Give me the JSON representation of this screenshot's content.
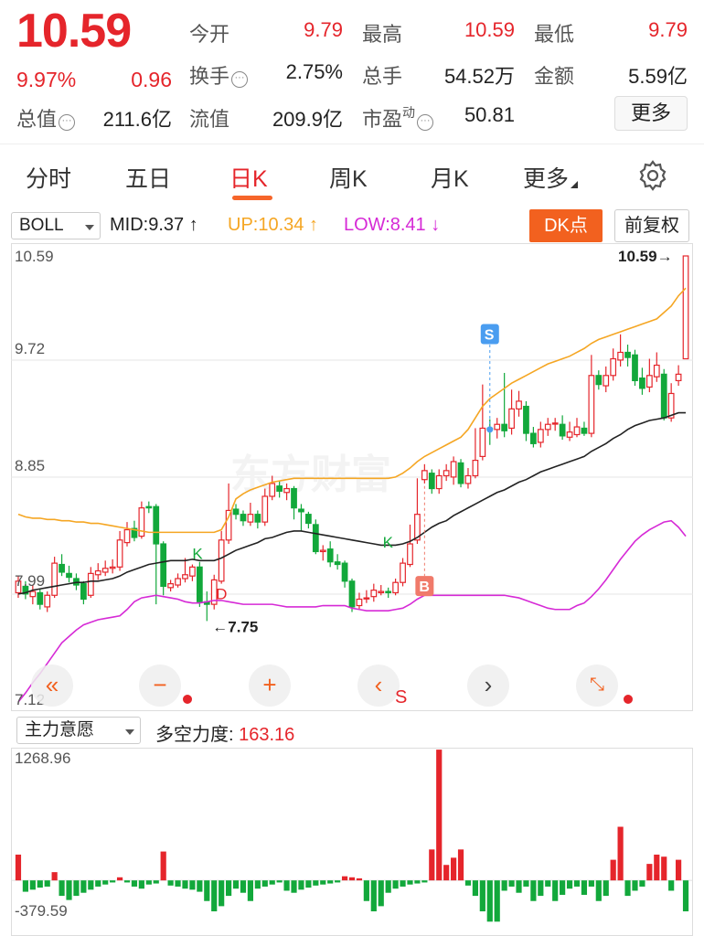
{
  "quote": {
    "price": "10.59",
    "change_pct": "9.97%",
    "change_abs": "0.96",
    "open_label": "今开",
    "open_value": "9.79",
    "high_label": "最高",
    "high_value": "10.59",
    "low_label": "最低",
    "low_value": "9.79",
    "turnover_label": "换手",
    "turnover_value": "2.75%",
    "volume_label": "总手",
    "volume_value": "54.52万",
    "amount_label": "金额",
    "amount_value": "5.59亿",
    "mktcap_label": "总值",
    "mktcap_value": "211.6亿",
    "float_label": "流值",
    "float_value": "209.9亿",
    "pe_label": "市盈",
    "pe_sup": "动",
    "pe_value": "50.81",
    "more_label": "更多"
  },
  "tabs": [
    {
      "label": "分时"
    },
    {
      "label": "五日"
    },
    {
      "label": "日K"
    },
    {
      "label": "周K"
    },
    {
      "label": "月K"
    },
    {
      "label": "更多"
    }
  ],
  "active_tab": "日K",
  "indicator": {
    "selector": "BOLL",
    "mid": "MID:9.37",
    "up": "UP:10.34",
    "low": "LOW:8.41",
    "dk_label": "DK点",
    "adjust_label": "前复权",
    "colors": {
      "mid": "#222222",
      "up": "#f5a623",
      "low": "#d62ad6",
      "rise": "#e5252b",
      "fall": "#12a83b"
    }
  },
  "main_axis": {
    "labels": [
      "10.59",
      "9.72",
      "8.85",
      "7.99",
      "7.12"
    ]
  },
  "annotations": {
    "high_marker": "10.59",
    "low_marker": "7.75",
    "k_label": "K",
    "d_label": "D",
    "s_label": "S",
    "b_label": "B"
  },
  "sub_indicator": {
    "selector": "主力意愿",
    "title": "多空力度:",
    "value": "163.16",
    "axis_top": "1268.96",
    "axis_bottom": "-379.59"
  },
  "controls": {
    "rewind_icon": "double-chevron-left-icon",
    "zoom_out_icon": "minus-icon",
    "zoom_in_icon": "plus-icon",
    "prev_icon": "chevron-left-icon",
    "next_icon": "chevron-right-icon",
    "fullscreen_icon": "expand-icon",
    "prev_sub": "S"
  },
  "chart_data": {
    "type": "candlestick",
    "ylim": [
      7.12,
      10.59
    ],
    "candles": [
      [
        7.97,
        8.06,
        8.1,
        7.93
      ],
      [
        8.02,
        7.96,
        8.06,
        7.92
      ],
      [
        7.94,
        7.98,
        8.03,
        7.88
      ],
      [
        7.97,
        7.88,
        8.0,
        7.84
      ],
      [
        7.86,
        7.95,
        7.98,
        7.82
      ],
      [
        7.95,
        8.2,
        8.25,
        7.93
      ],
      [
        8.19,
        8.13,
        8.27,
        8.1
      ],
      [
        8.12,
        8.09,
        8.18,
        8.05
      ],
      [
        8.08,
        8.03,
        8.12,
        7.99
      ],
      [
        8.04,
        7.92,
        8.06,
        7.88
      ],
      [
        7.95,
        8.12,
        8.17,
        7.93
      ],
      [
        8.11,
        8.14,
        8.2,
        8.07
      ],
      [
        8.13,
        8.16,
        8.22,
        8.1
      ],
      [
        8.16,
        8.17,
        8.23,
        8.12
      ],
      [
        8.17,
        8.38,
        8.45,
        8.14
      ],
      [
        8.36,
        8.46,
        8.52,
        8.33
      ],
      [
        8.47,
        8.4,
        8.53,
        8.37
      ],
      [
        8.41,
        8.63,
        8.68,
        8.39
      ],
      [
        8.64,
        8.63,
        8.68,
        8.59
      ],
      [
        8.64,
        8.35,
        8.66,
        7.88
      ],
      [
        8.35,
        8.02,
        8.37,
        7.95
      ],
      [
        8.01,
        8.04,
        8.07,
        7.98
      ],
      [
        8.03,
        8.08,
        8.12,
        8.01
      ],
      [
        8.08,
        8.11,
        8.24,
        8.05
      ],
      [
        8.1,
        8.17,
        8.19,
        8.06
      ],
      [
        8.17,
        7.9,
        8.21,
        7.86
      ],
      [
        7.9,
        7.88,
        7.98,
        7.75
      ],
      [
        7.88,
        8.07,
        8.11,
        7.84
      ],
      [
        8.06,
        8.38,
        8.45,
        8.04
      ],
      [
        8.38,
        8.61,
        8.82,
        8.35
      ],
      [
        8.62,
        8.58,
        8.66,
        8.54
      ],
      [
        8.58,
        8.53,
        8.61,
        8.49
      ],
      [
        8.52,
        8.58,
        8.67,
        8.49
      ],
      [
        8.58,
        8.52,
        8.61,
        8.47
      ],
      [
        8.52,
        8.72,
        8.78,
        8.49
      ],
      [
        8.72,
        8.82,
        8.88,
        8.69
      ],
      [
        8.8,
        8.76,
        8.84,
        8.71
      ],
      [
        8.75,
        8.78,
        8.82,
        8.69
      ],
      [
        8.78,
        8.63,
        8.8,
        8.54
      ],
      [
        8.62,
        8.6,
        8.66,
        8.45
      ],
      [
        8.58,
        8.51,
        8.6,
        8.47
      ],
      [
        8.5,
        8.29,
        8.54,
        8.27
      ],
      [
        8.29,
        8.3,
        8.34,
        8.22
      ],
      [
        8.31,
        8.21,
        8.37,
        8.17
      ],
      [
        8.21,
        8.19,
        8.27,
        8.15
      ],
      [
        8.2,
        8.06,
        8.22,
        8.01
      ],
      [
        8.06,
        7.86,
        8.08,
        7.82
      ],
      [
        7.87,
        7.92,
        7.97,
        7.84
      ],
      [
        7.93,
        7.93,
        7.99,
        7.89
      ],
      [
        7.94,
        7.99,
        8.04,
        7.9
      ],
      [
        7.97,
        7.98,
        8.03,
        7.95
      ],
      [
        7.98,
        7.97,
        8.01,
        7.93
      ],
      [
        7.97,
        8.05,
        8.08,
        7.95
      ],
      [
        8.05,
        8.2,
        8.24,
        8.02
      ],
      [
        8.19,
        8.35,
        8.5,
        8.17
      ],
      [
        8.38,
        8.58,
        8.86,
        8.35
      ],
      [
        8.85,
        8.92,
        8.97,
        8.82
      ],
      [
        8.9,
        8.78,
        8.93,
        8.74
      ],
      [
        8.78,
        8.88,
        8.93,
        8.74
      ],
      [
        8.88,
        8.92,
        8.97,
        8.84
      ],
      [
        8.87,
        8.99,
        9.03,
        8.81
      ],
      [
        8.98,
        8.82,
        9.01,
        8.79
      ],
      [
        8.82,
        8.88,
        8.94,
        8.78
      ],
      [
        8.88,
        9.0,
        9.25,
        8.86
      ],
      [
        9.03,
        9.25,
        9.59,
        9.0
      ],
      [
        9.25,
        9.24,
        9.32,
        9.12
      ],
      [
        9.24,
        9.28,
        9.33,
        9.17
      ],
      [
        9.28,
        9.23,
        9.68,
        9.18
      ],
      [
        9.25,
        9.4,
        9.55,
        9.2
      ],
      [
        9.4,
        9.46,
        9.54,
        9.34
      ],
      [
        9.42,
        9.21,
        9.46,
        9.15
      ],
      [
        9.21,
        9.13,
        9.26,
        9.1
      ],
      [
        9.14,
        9.24,
        9.3,
        9.1
      ],
      [
        9.24,
        9.28,
        9.33,
        9.19
      ],
      [
        9.29,
        9.29,
        9.33,
        9.23
      ],
      [
        9.28,
        9.19,
        9.35,
        9.16
      ],
      [
        9.18,
        9.22,
        9.3,
        9.15
      ],
      [
        9.2,
        9.26,
        9.33,
        9.18
      ],
      [
        9.25,
        9.21,
        9.3,
        9.19
      ],
      [
        9.21,
        9.66,
        9.82,
        9.18
      ],
      [
        9.66,
        9.59,
        9.7,
        9.55
      ],
      [
        9.58,
        9.66,
        9.73,
        9.53
      ],
      [
        9.66,
        9.79,
        9.87,
        9.62
      ],
      [
        9.78,
        9.84,
        9.98,
        9.73
      ],
      [
        9.84,
        9.8,
        9.9,
        9.73
      ],
      [
        9.82,
        9.62,
        9.86,
        9.58
      ],
      [
        9.64,
        9.56,
        9.72,
        9.51
      ],
      [
        9.57,
        9.66,
        9.79,
        9.53
      ],
      [
        9.65,
        9.74,
        9.84,
        9.61
      ],
      [
        9.67,
        9.33,
        9.71,
        9.31
      ],
      [
        9.33,
        9.52,
        9.6,
        9.3
      ],
      [
        9.62,
        9.67,
        9.74,
        9.58
      ],
      [
        9.79,
        10.59,
        10.59,
        9.79
      ]
    ],
    "boll_mid": [
      7.96,
      7.97,
      7.99,
      8.0,
      8.01,
      8.02,
      8.03,
      8.04,
      8.05,
      8.05,
      8.06,
      8.06,
      8.07,
      8.08,
      8.1,
      8.13,
      8.15,
      8.17,
      8.19,
      8.2,
      8.21,
      8.22,
      8.22,
      8.22,
      8.23,
      8.22,
      8.22,
      8.22,
      8.24,
      8.27,
      8.3,
      8.32,
      8.34,
      8.36,
      8.39,
      8.4,
      8.42,
      8.44,
      8.45,
      8.45,
      8.44,
      8.43,
      8.42,
      8.41,
      8.4,
      8.39,
      8.38,
      8.37,
      8.36,
      8.35,
      8.34,
      8.34,
      8.34,
      8.35,
      8.37,
      8.4,
      8.44,
      8.48,
      8.51,
      8.53,
      8.57,
      8.6,
      8.63,
      8.66,
      8.69,
      8.72,
      8.75,
      8.77,
      8.8,
      8.83,
      8.85,
      8.88,
      8.91,
      8.93,
      8.95,
      8.97,
      8.99,
      9.01,
      9.03,
      9.07,
      9.1,
      9.13,
      9.17,
      9.2,
      9.24,
      9.27,
      9.29,
      9.31,
      9.32,
      9.33,
      9.35,
      9.37,
      9.37
    ],
    "boll_up": [
      8.58,
      8.56,
      8.55,
      8.55,
      8.54,
      8.54,
      8.53,
      8.53,
      8.52,
      8.52,
      8.51,
      8.51,
      8.5,
      8.49,
      8.48,
      8.47,
      8.46,
      8.45,
      8.44,
      8.44,
      8.44,
      8.44,
      8.44,
      8.44,
      8.44,
      8.44,
      8.44,
      8.44,
      8.46,
      8.56,
      8.7,
      8.74,
      8.77,
      8.79,
      8.81,
      8.83,
      8.84,
      8.85,
      8.86,
      8.86,
      8.86,
      8.86,
      8.86,
      8.86,
      8.86,
      8.86,
      8.86,
      8.86,
      8.86,
      8.86,
      8.86,
      8.86,
      8.87,
      8.9,
      8.94,
      8.99,
      9.03,
      9.06,
      9.09,
      9.12,
      9.15,
      9.18,
      9.24,
      9.33,
      9.42,
      9.48,
      9.52,
      9.56,
      9.6,
      9.63,
      9.66,
      9.69,
      9.72,
      9.75,
      9.77,
      9.79,
      9.81,
      9.84,
      9.87,
      9.91,
      9.94,
      9.96,
      9.98,
      10.0,
      10.02,
      10.04,
      10.06,
      10.08,
      10.1,
      10.15,
      10.2,
      10.28,
      10.34
    ],
    "boll_low": [
      7.12,
      7.19,
      7.27,
      7.34,
      7.42,
      7.5,
      7.58,
      7.63,
      7.68,
      7.72,
      7.74,
      7.76,
      7.77,
      7.78,
      7.79,
      7.84,
      7.9,
      7.93,
      7.94,
      7.95,
      7.94,
      7.93,
      7.92,
      7.9,
      7.89,
      7.89,
      7.9,
      7.91,
      7.91,
      7.9,
      7.89,
      7.88,
      7.88,
      7.88,
      7.88,
      7.88,
      7.87,
      7.86,
      7.86,
      7.86,
      7.86,
      7.86,
      7.87,
      7.87,
      7.87,
      7.87,
      7.85,
      7.84,
      7.83,
      7.83,
      7.83,
      7.83,
      7.84,
      7.85,
      7.88,
      7.92,
      7.95,
      7.95,
      7.95,
      7.95,
      7.95,
      7.95,
      7.95,
      7.95,
      7.95,
      7.95,
      7.95,
      7.95,
      7.94,
      7.93,
      7.91,
      7.89,
      7.87,
      7.85,
      7.84,
      7.84,
      7.84,
      7.87,
      7.89,
      7.94,
      8.0,
      8.07,
      8.15,
      8.23,
      8.3,
      8.37,
      8.42,
      8.46,
      8.49,
      8.52,
      8.53,
      8.48,
      8.41
    ],
    "force": [
      250,
      -110,
      -90,
      -70,
      -60,
      80,
      -150,
      -190,
      -150,
      -120,
      -90,
      -60,
      -40,
      -20,
      30,
      -20,
      -60,
      -80,
      -40,
      -30,
      280,
      -50,
      -60,
      -80,
      -90,
      -110,
      -200,
      -300,
      -250,
      -150,
      -80,
      -120,
      -200,
      -80,
      -60,
      -40,
      -20,
      -100,
      -120,
      -90,
      -70,
      -50,
      -40,
      -30,
      -20,
      40,
      30,
      20,
      -200,
      -300,
      -250,
      -120,
      -80,
      -60,
      -40,
      -30,
      -20,
      300,
      1268,
      150,
      220,
      300,
      -50,
      -150,
      -300,
      -400,
      -400,
      -100,
      -60,
      -120,
      -60,
      -200,
      -150,
      -60,
      -200,
      -140,
      -80,
      -60,
      -140,
      -60,
      -200,
      -150,
      200,
      520,
      -150,
      -100,
      -60,
      160,
      250,
      230,
      -100,
      200,
      -300
    ],
    "force_ylim": [
      -379.59,
      1268.96
    ]
  }
}
